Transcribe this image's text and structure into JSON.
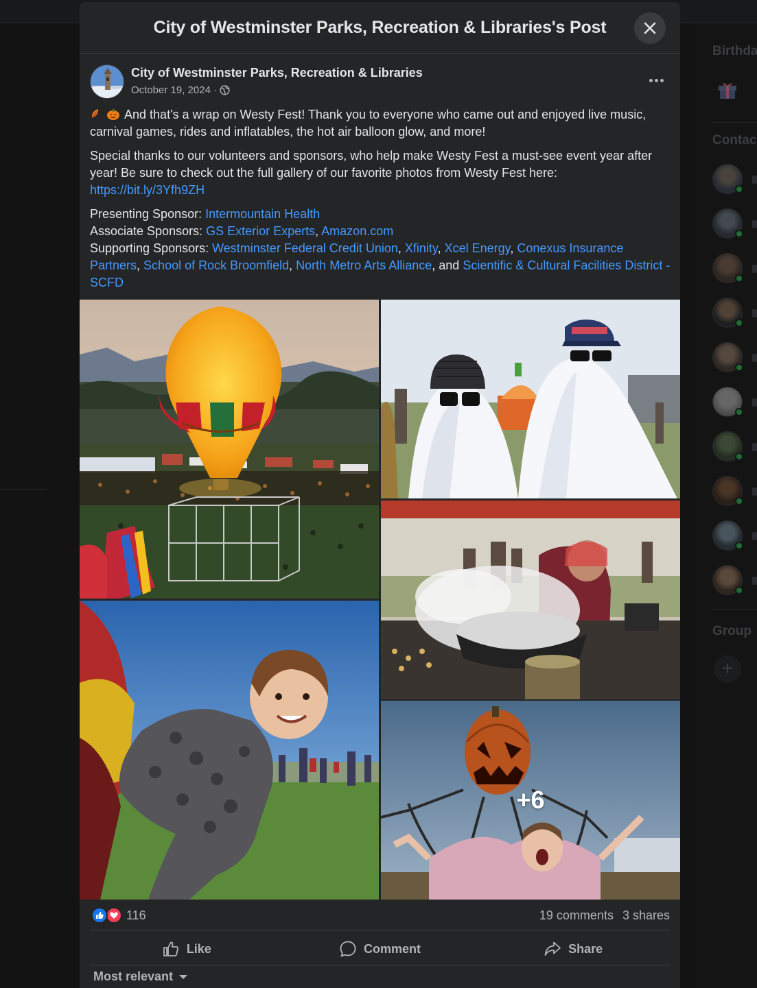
{
  "modal": {
    "title": "City of Westminster Parks, Recreation & Libraries's Post"
  },
  "post": {
    "author": "City of Westminster Parks, Recreation & Libraries",
    "date": "October 19, 2024 ·",
    "paragraph1": "And that's a wrap on Westy Fest! Thank you to everyone who came out and enjoyed live music, carnival games, rides and inflatables, the hot air balloon glow, and more!",
    "paragraph2": "Special thanks to our volunteers and sponsors, who help make Westy Fest a must-see event year after year! Be sure to check out the full gallery of our favorite photos from Westy Fest here:",
    "gallery_link": "https://bit.ly/3Yfh9ZH",
    "presenting_label": "Presenting Sponsor:",
    "presenting": [
      "Intermountain Health"
    ],
    "associate_label": "Associate Sponsors:",
    "associate": [
      "GS Exterior Experts",
      "Amazon.com"
    ],
    "supporting_label": "Supporting Sponsors:",
    "supporting": [
      "Westminster Federal Credit Union",
      "Xfinity",
      "Xcel Energy",
      "Conexus Insurance Partners",
      "School of Rock Broomfield",
      "North Metro Arts Alliance",
      "Scientific & Cultural Facilities District - SCFD"
    ],
    "and_word": "and"
  },
  "gallery": {
    "more_count": "+6"
  },
  "stats": {
    "reactions": "116",
    "comments": "19 comments",
    "shares": "3 shares"
  },
  "actions": {
    "like": "Like",
    "comment": "Comment",
    "share": "Share"
  },
  "comments_sort": "Most relevant",
  "sidebar": {
    "birthdays_heading": "Birthda",
    "contacts_heading": "Contac",
    "groups_heading": "Group"
  },
  "colors": {
    "link": "#4599ff",
    "surface": "#242526",
    "like_blue": "#1877f2",
    "love_red": "#f33e58"
  }
}
